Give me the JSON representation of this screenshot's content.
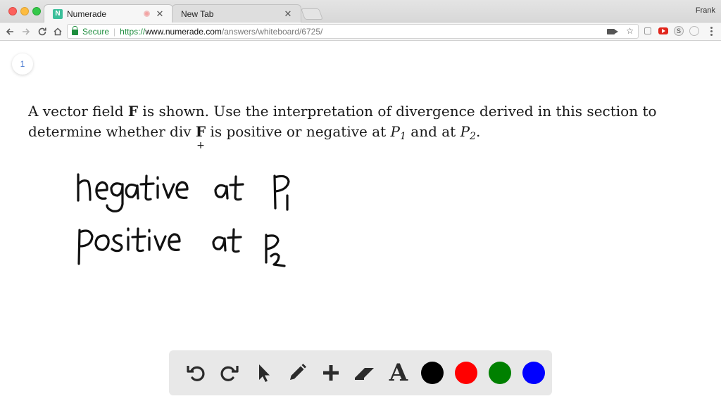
{
  "browser": {
    "tabs": [
      {
        "label": "Numerade",
        "favicon": "N",
        "active": true
      },
      {
        "label": "New Tab",
        "active": false
      }
    ],
    "profile": "Frank",
    "address": {
      "secure_label": "Secure",
      "scheme": "https://",
      "host": "www.numerade.com",
      "path": "/answers/whiteboard/6725/"
    }
  },
  "whiteboard": {
    "page_number": "1",
    "question": {
      "text_a": "A vector field ",
      "bold_f": "F",
      "text_b": " is shown. Use the interpretation of divergence derived in this section to",
      "text_c": "determine whether div ",
      "bold_f2": "F",
      "text_d": " is positive or negative at ",
      "p": "P",
      "sub1": "1",
      "text_e": " and at ",
      "sub2": "2",
      "text_f": "."
    },
    "handwriting": [
      "negative at P1",
      "positive at P2"
    ]
  },
  "toolbar": {
    "tools": [
      "undo-icon",
      "redo-icon",
      "pointer-icon",
      "pencil-icon",
      "plus-icon",
      "eraser-icon",
      "text-icon"
    ],
    "text_tool_label": "A",
    "colors": [
      "#000000",
      "#ff0000",
      "#008000",
      "#0000ff"
    ]
  }
}
